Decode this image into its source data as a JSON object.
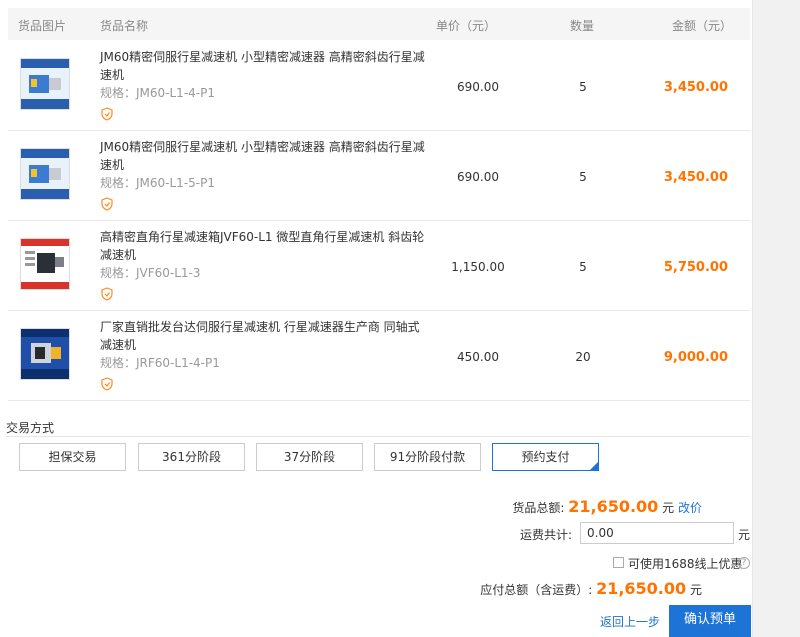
{
  "table": {
    "headers": {
      "image": "货品图片",
      "name": "货品名称",
      "price": "单价（元）",
      "qty": "数量",
      "amount": "金额（元）"
    },
    "rows": [
      {
        "title": "JM60精密伺服行星减速机 小型精密减速器 高精密斜齿行星减速机",
        "spec": "规格：JM60-L1-4-P1",
        "price": "690.00",
        "qty": "5",
        "amount": "3,450.00"
      },
      {
        "title": "JM60精密伺服行星减速机 小型精密减速器 高精密斜齿行星减速机",
        "spec": "规格：JM60-L1-5-P1",
        "price": "690.00",
        "qty": "5",
        "amount": "3,450.00"
      },
      {
        "title": "高精密直角行星减速箱JVF60-L1 微型直角行星减速机 斜齿轮减速机",
        "spec": "规格：JVF60-L1-3",
        "price": "1,150.00",
        "qty": "5",
        "amount": "5,750.00"
      },
      {
        "title": "厂家直销批发台达伺服行星减速机 行星减速器生产商 同轴式减速机",
        "spec": "规格：JRF60-L1-4-P1",
        "price": "450.00",
        "qty": "20",
        "amount": "9,000.00"
      }
    ]
  },
  "trade": {
    "label": "交易方式",
    "options": [
      "担保交易",
      "361分阶段",
      "37分阶段",
      "91分阶段付款",
      "预约支付"
    ],
    "selected": "预约支付"
  },
  "summary": {
    "goods_total_label": "货品总额:",
    "goods_total_value": "21,650.00",
    "goods_total_unit": "元",
    "edit_price": "改价",
    "freight_label": "运费共计:",
    "freight_value": "0.00",
    "freight_unit": "元",
    "discount_label": "可使用1688线上优惠",
    "payable_label": "应付总额（含运费）:",
    "payable_value": "21,650.00",
    "payable_unit": "元",
    "back_link": "返回上一步",
    "confirm_button": "确认预单"
  },
  "colors": {
    "accent_orange": "#ff7300",
    "link_blue": "#1e74d6"
  }
}
